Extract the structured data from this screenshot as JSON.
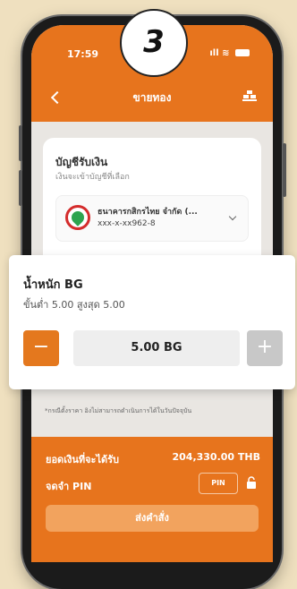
{
  "step": {
    "number": "3"
  },
  "status_bar": {
    "time": "17:59",
    "signal": "ıll"
  },
  "nav": {
    "title": "ขายทอง"
  },
  "account": {
    "title": "บัญชีรับเงิน",
    "subtitle": "เงินจะเข้าบัญชีที่เลือก",
    "bank_name": "ธนาคารกสิกรไทย จำกัด (...",
    "account_number": "xxx-x-xx962-8"
  },
  "weight": {
    "title": "น้ำหนัก BG",
    "limits": "ขั้นต่ำ 5.00  สูงสุด 5.00",
    "minus_label": "−",
    "value": "5.00 BG",
    "plus_label": "+"
  },
  "note": "*กรณีตั้งราคา อิงไม่สามารถดำเนินการได้ในวันปัจจุบัน",
  "footer": {
    "receive_label": "ยอดเงินที่จะได้รับ",
    "receive_amount": "204,330.00 THB",
    "remember_pin_label": "จดจำ PIN",
    "pin_button": "PIN",
    "submit_label": "ส่งคำสั่ง"
  },
  "colors": {
    "brand": "#e7741d",
    "brand_light": "#f2a35e",
    "disabled": "#c8c8c8"
  }
}
